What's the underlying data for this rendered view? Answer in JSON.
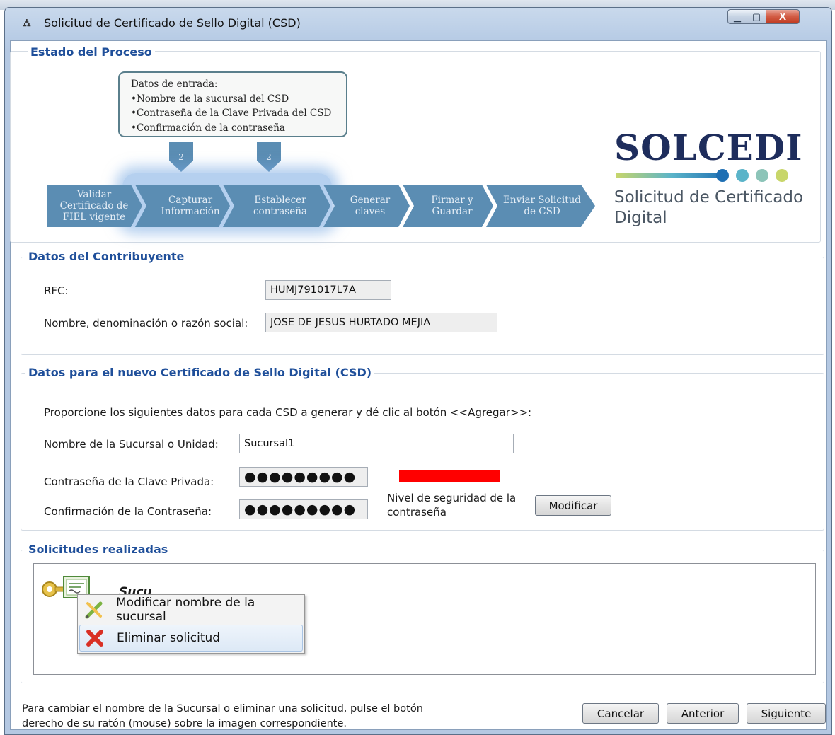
{
  "window": {
    "title": "Solicitud de Certificado de Sello Digital (CSD)",
    "controls": {
      "minimize": "▁",
      "maximize": "▢",
      "close": "X"
    }
  },
  "estado": {
    "legend": "Estado del Proceso",
    "callout": [
      "Datos de entrada:",
      "•Nombre de la sucursal del CSD",
      "•Contraseña de la Clave Privada del CSD",
      "•Confirmación de la contraseña"
    ],
    "arrow_numbers": [
      "2",
      "2"
    ],
    "steps": [
      {
        "label": "Validar Certificado de FIEL vigente",
        "highlighted": false
      },
      {
        "label": "Capturar Información",
        "highlighted": true
      },
      {
        "label": "Establecer contraseña",
        "highlighted": true
      },
      {
        "label": "Generar claves",
        "highlighted": false
      },
      {
        "label": "Firmar y Guardar",
        "highlighted": false
      },
      {
        "label": "Enviar Solicitud de CSD",
        "highlighted": false
      }
    ],
    "step_color": "#5b8db3",
    "logo": {
      "word": "SOLCEDI",
      "subtitle_line1": "Solicitud de Certificado",
      "subtitle_line2": "Digital",
      "dot_colors": [
        "#1e6fb3",
        "#5bb4c9",
        "#8cc4b8",
        "#c8d66a"
      ]
    }
  },
  "contribuyente": {
    "legend": "Datos del Contribuyente",
    "rfc_label": "RFC:",
    "rfc_value": "HUMJ791017L7A",
    "nombre_label": "Nombre, denominación o razón social:",
    "nombre_value": "JOSE DE JESUS HURTADO MEJIA"
  },
  "csd": {
    "legend": "Datos para el nuevo Certificado de Sello Digital (CSD)",
    "instructions": "Proporcione los siguientes datos para cada CSD a generar y dé clic al botón <<Agregar>>:",
    "sucursal_label": "Nombre de la Sucursal o Unidad:",
    "sucursal_value": "Sucursal1",
    "password_label": "Contraseña de la Clave Privada:",
    "password_value": "●●●●●●●●●",
    "confirm_label": "Confirmación de la Contraseña:",
    "confirm_value": "●●●●●●●●●",
    "strength_label_line1": "Nivel de seguridad de la",
    "strength_label_line2": "contraseña",
    "strength_color": "#ff0000",
    "modify_button": "Modificar"
  },
  "solicitudes": {
    "legend": "Solicitudes realizadas",
    "item_label": "Sucu",
    "context_menu": [
      {
        "label": "Modificar nombre de la sucursal",
        "icon": "edit-pencil-icon"
      },
      {
        "label": "Eliminar solicitud",
        "icon": "delete-x-icon"
      }
    ]
  },
  "footer": {
    "hint_line1": "Para cambiar el nombre de la Sucursal o eliminar una solicitud, pulse el botón",
    "hint_line2": "derecho de su ratón (mouse) sobre la imagen correspondiente.",
    "buttons": {
      "cancel": "Cancelar",
      "back": "Anterior",
      "next": "Siguiente"
    }
  }
}
